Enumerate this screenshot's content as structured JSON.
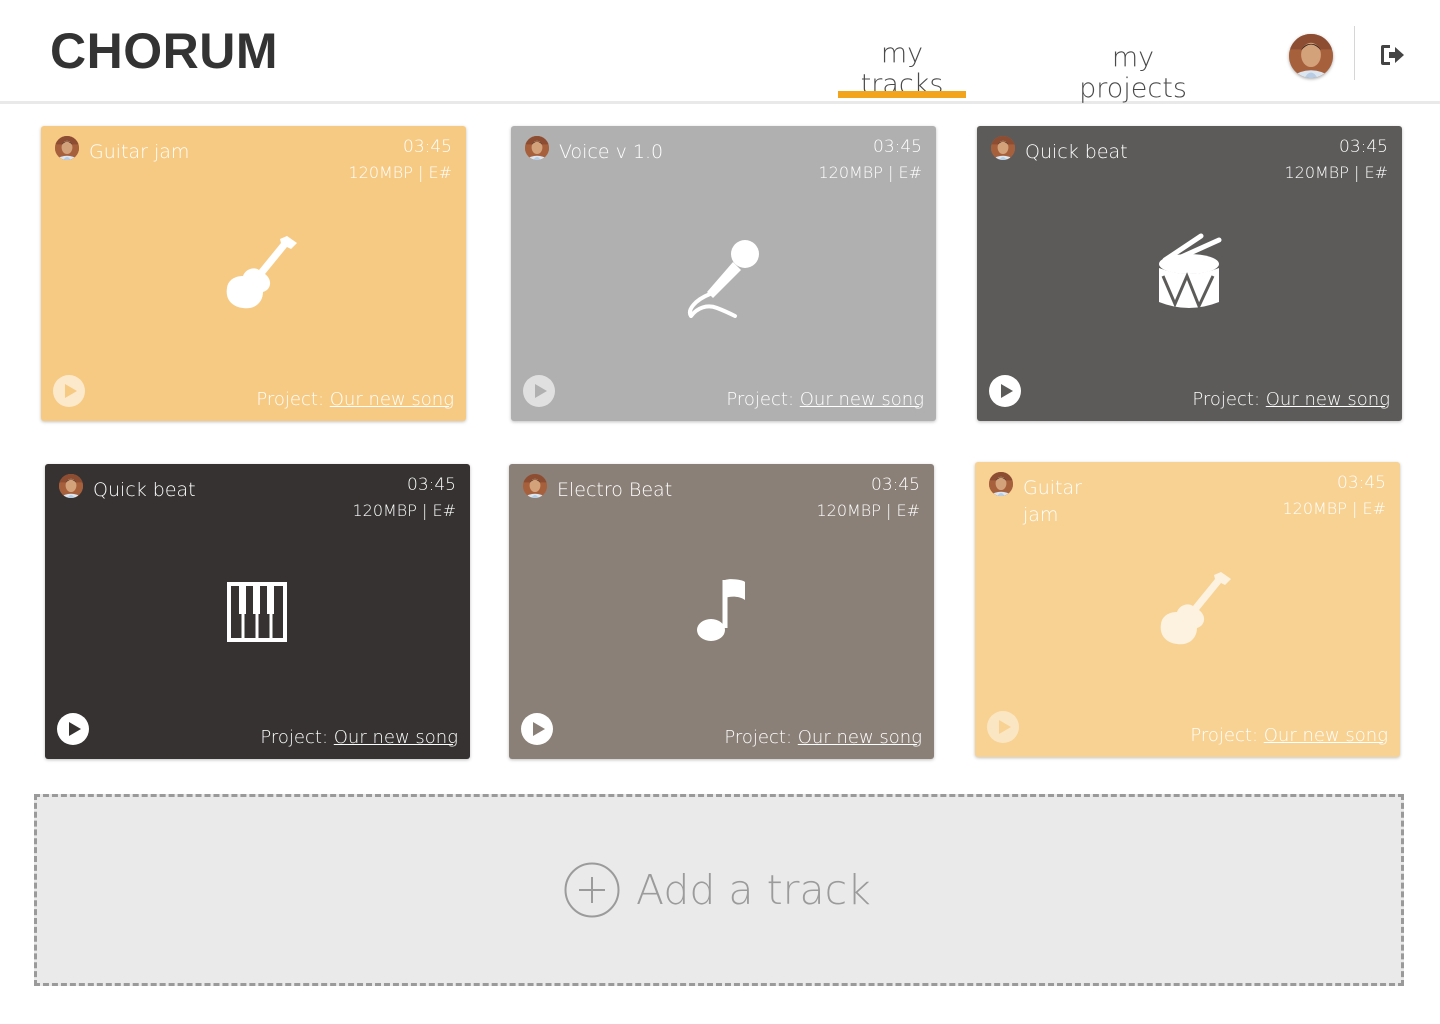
{
  "app": {
    "logo": "CHORUM"
  },
  "nav": {
    "tabs": [
      {
        "label": "my tracks",
        "active": true
      },
      {
        "label": "my projects",
        "active": false
      }
    ],
    "accent_color": "#f3a41d"
  },
  "user": {
    "avatar": "user-avatar",
    "logout_icon": "sign-out-icon"
  },
  "tracks": [
    {
      "title": "Guitar jam",
      "time": "03:45",
      "meta": "120MBP | E#",
      "instrument_icon": "guitar-icon",
      "project_prefix": "Project:",
      "project_name": "Our new song",
      "color": "#f7ca83"
    },
    {
      "title": "Voice v 1.0",
      "time": "03:45",
      "meta": "120MBP | E#",
      "instrument_icon": "microphone-icon",
      "project_prefix": "Project:",
      "project_name": "Our new song",
      "color": "#b0b0b0"
    },
    {
      "title": "Quick beat",
      "time": "03:45",
      "meta": "120MBP | E#",
      "instrument_icon": "drum-icon",
      "project_prefix": "Project:",
      "project_name": "Our new song",
      "color": "#5c5b5a"
    },
    {
      "title": "Quick beat",
      "time": "03:45",
      "meta": "120MBP | E#",
      "instrument_icon": "piano-keys-icon",
      "project_prefix": "Project:",
      "project_name": "Our new song",
      "color": "#353231"
    },
    {
      "title": "Electro Beat",
      "time": "03:45",
      "meta": "120MBP | E#",
      "instrument_icon": "music-note-icon",
      "project_prefix": "Project:",
      "project_name": "Our new song",
      "color": "#8a8077"
    },
    {
      "title": "Guitar jam",
      "time": "03:45",
      "meta": "120MBP | E#",
      "instrument_icon": "guitar-icon",
      "project_prefix": "Project:",
      "project_name": "Our new song",
      "color": "#f8d293"
    }
  ],
  "add_track": {
    "label": "Add a track",
    "icon": "plus-circle-icon"
  }
}
